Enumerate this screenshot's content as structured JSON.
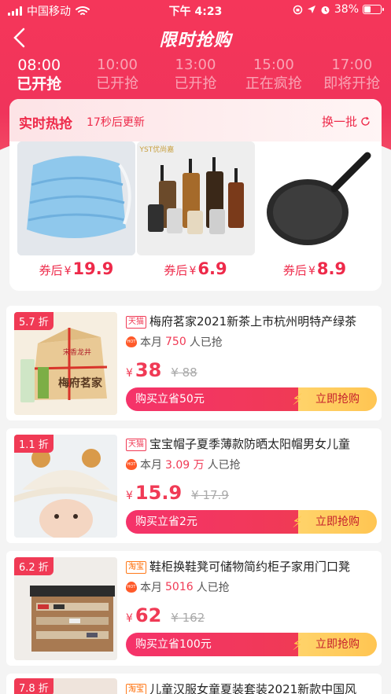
{
  "status_bar": {
    "carrier": "中国移动",
    "time": "下午 4:23",
    "battery": "38%",
    "battery_level": 0.38
  },
  "header": {
    "title": "限时抢购"
  },
  "time_tabs": [
    {
      "time": "08:00",
      "status": "已开抢",
      "active": true
    },
    {
      "time": "10:00",
      "status": "已开抢",
      "active": false
    },
    {
      "time": "13:00",
      "status": "已开抢",
      "active": false
    },
    {
      "time": "15:00",
      "status": "正在疯抢",
      "active": false
    },
    {
      "time": "17:00",
      "status": "即将开抢",
      "active": false
    }
  ],
  "hot_section": {
    "title": "实时热抢",
    "subtitle": "17秒后更新",
    "refresh_label": "换一批",
    "items": [
      {
        "image": "face-mask",
        "label": "券后",
        "currency": "¥",
        "price": "19.9"
      },
      {
        "image": "oil-bottles",
        "label": "券后",
        "currency": "¥",
        "price": "6.9",
        "brand": "YST优尚嘉"
      },
      {
        "image": "frying-pan",
        "label": "券后",
        "currency": "¥",
        "price": "8.9"
      }
    ]
  },
  "products": [
    {
      "discount": "5.7 折",
      "platform": "天猫",
      "name": "梅府茗家2021新茶上市杭州明特产绿茶",
      "sold_prefix": "本月",
      "sold_count": "750",
      "sold_suffix": "人已抢",
      "currency": "¥",
      "price": "38",
      "original_price": "¥ 88",
      "save_label": "购买立省50元",
      "buy_label": "立即抢购",
      "image": "tea-package",
      "image_text_1": "宋香龙井",
      "image_text_2": "梅府茗家"
    },
    {
      "discount": "1.1 折",
      "platform": "天猫",
      "name": "宝宝帽子夏季薄款防晒太阳帽男女儿童",
      "sold_prefix": "本月",
      "sold_count": "3.09 万",
      "sold_suffix": "人已抢",
      "currency": "¥",
      "price": "15.9",
      "original_price": "¥ 17.9",
      "save_label": "购买立省2元",
      "buy_label": "立即抢购",
      "image": "baby-hat"
    },
    {
      "discount": "6.2 折",
      "platform": "淘宝",
      "name": "鞋柜换鞋凳可储物简约柜子家用门口凳",
      "sold_prefix": "本月",
      "sold_count": "5016",
      "sold_suffix": "人已抢",
      "currency": "¥",
      "price": "62",
      "original_price": "¥ 162",
      "save_label": "购买立省100元",
      "buy_label": "立即抢购",
      "image": "shoe-cabinet"
    },
    {
      "discount": "7.8 折",
      "platform": "淘宝",
      "name": "儿童汉服女童夏装套装2021新款中国风",
      "image": "kids-hanfu"
    }
  ],
  "colors": {
    "primary": "#f03a55",
    "buy_button": "#ffc552",
    "background": "#f4f4f4"
  }
}
